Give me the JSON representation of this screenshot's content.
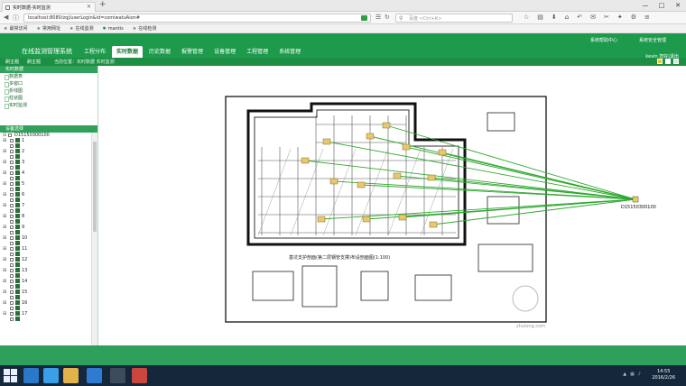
{
  "browser": {
    "tab_title": "实时数据-实时监测",
    "url": "localhost:8080/zqj/userLogin&id=comiwatuAion#",
    "search_placeholder": "百度 <Ctrl+K>",
    "new_tab": "+",
    "window_controls": [
      "—",
      "□",
      "✕"
    ],
    "bookmarks": [
      "最常访问",
      "常用网址",
      "在线监测",
      "mantis",
      "在线检测"
    ]
  },
  "header": {
    "app_name": "在线监测管理系统",
    "links": [
      "系统帮助中心",
      "系统安全管理"
    ],
    "menu": [
      {
        "label": "工程分布",
        "active": false
      },
      {
        "label": "实时数据",
        "active": true
      },
      {
        "label": "历史数据",
        "active": false
      },
      {
        "label": "报警管理",
        "active": false
      },
      {
        "label": "设备管理",
        "active": false
      },
      {
        "label": "工程管理",
        "active": false
      },
      {
        "label": "系统管理",
        "active": false
      }
    ]
  },
  "subbar": {
    "tabs": [
      "刷主题",
      "刷主题"
    ],
    "breadcrumb": "当前位置：实时数据 实时监测",
    "user_text": "kevin 您好|退出"
  },
  "sidebar": {
    "realtime_header": "实时数据",
    "realtime_items": [
      "数据表",
      "多窗口",
      "折线图",
      "柱状图",
      "实时监测"
    ],
    "device_header": "设备选择",
    "root_node": "D15150300100",
    "nodes": [
      "1",
      "2",
      "3",
      "4",
      "5",
      "6",
      "7",
      "8",
      "9",
      "10",
      "11",
      "12",
      "13",
      "14",
      "15",
      "16",
      "17"
    ]
  },
  "drawing": {
    "device_label": "D15150300100",
    "title": "基坑支护剖面(第二层钢管支撑)布设剖面图(1:100)",
    "watermark": "zhulong.com"
  },
  "taskbar": {
    "time": "14:55",
    "date": "2016/2/26"
  }
}
